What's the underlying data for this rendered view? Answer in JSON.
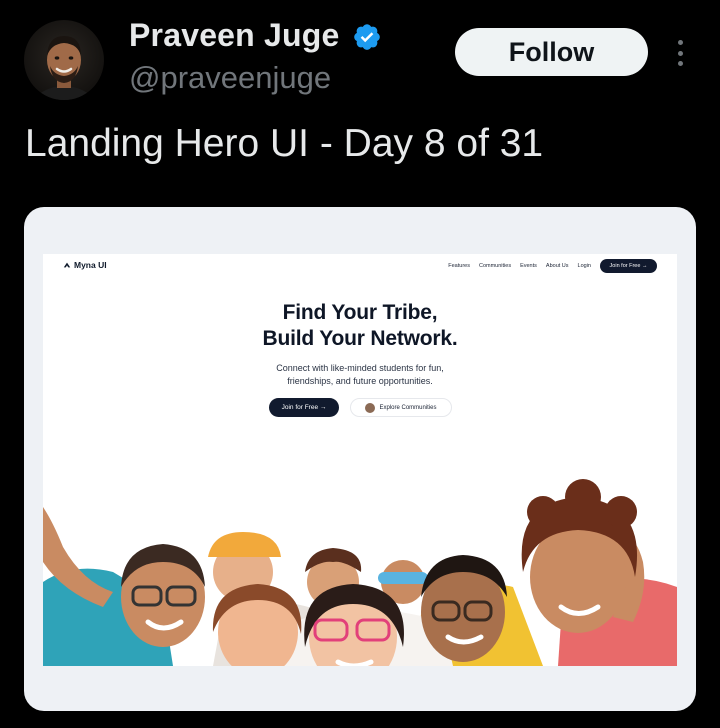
{
  "tweet": {
    "display_name": "Praveen Juge",
    "handle": "@praveenjuge",
    "follow_label": "Follow",
    "text": "Landing Hero UI - Day 8 of 31"
  },
  "icons": {
    "verified": "verified-badge-icon",
    "more": "more-options-icon"
  },
  "colors": {
    "background": "#000000",
    "verified_blue": "#1d9bf0",
    "follow_bg": "#eff3f4",
    "muted": "#71767b"
  },
  "preview": {
    "brand": "Myna UI",
    "nav": [
      "Features",
      "Communities",
      "Events",
      "About Us",
      "Login"
    ],
    "nav_cta": "Join for Free →",
    "headline_line1": "Find Your Tribe,",
    "headline_line2": "Build Your Network.",
    "sub_line1": "Connect with like-minded students for fun,",
    "sub_line2": "friendships, and future opportunities.",
    "primary_cta": "Join for Free →",
    "secondary_cta": "Explore Communities"
  }
}
